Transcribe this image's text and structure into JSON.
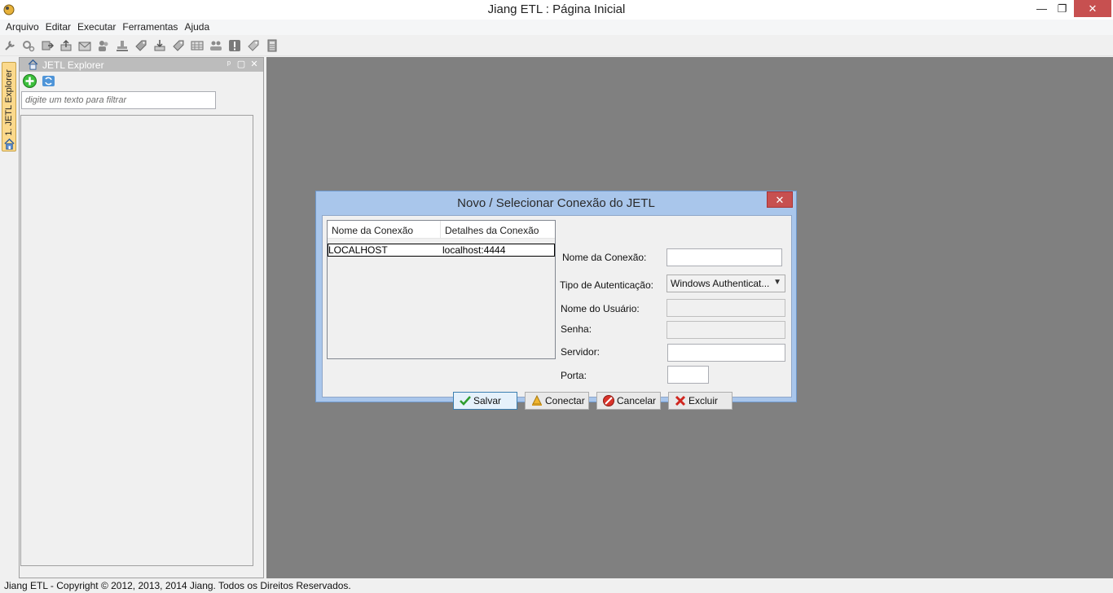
{
  "window": {
    "title": "Jiang ETL : Página Inicial",
    "minimize": "—",
    "maximize": "❐",
    "close": "✕"
  },
  "menu": [
    "Arquivo",
    "Editar",
    "Executar",
    "Ferramentas",
    "Ajuda"
  ],
  "toolbar": {
    "icons": [
      "wrench-icon",
      "gear-cluster-icon",
      "export-icon",
      "upload-icon",
      "mail-icon",
      "users-icon",
      "stamp-icon",
      "tag-icon",
      "download-icon",
      "tag-icon-2",
      "table-icon",
      "group-icon",
      "alert-icon",
      "tag-icon-3",
      "calculator-icon"
    ]
  },
  "left_strip": {
    "tab_label": "1. JETL Explorer"
  },
  "explorer": {
    "title": "JETL Explorer",
    "pin": "ᵖ",
    "float": "▢",
    "close": "✕",
    "filter_placeholder": "digite um texto para filtrar"
  },
  "dialog": {
    "title": "Novo / Selecionar Conexão do JETL",
    "close": "✕",
    "table": {
      "headers": [
        "Nome da Conexão",
        "Detalhes da Conexão"
      ],
      "rows": [
        [
          "LOCALHOST",
          "localhost:4444"
        ]
      ]
    },
    "form": {
      "connection_name_label": "Nome da Conexão:",
      "connection_name_value": "",
      "auth_type_label": "Tipo de Autenticação:",
      "auth_type_value": "Windows Authenticat...",
      "username_label": "Nome do Usuário:",
      "username_value": "",
      "password_label": "Senha:",
      "password_value": "",
      "server_label": "Servidor:",
      "server_value": "",
      "port_label": "Porta:",
      "port_value": ""
    },
    "buttons": {
      "save": "Salvar",
      "connect": "Conectar",
      "cancel": "Cancelar",
      "delete": "Excluir"
    }
  },
  "status": {
    "text": "Jiang ETL - Copyright © 2012, 2013, 2014 Jiang. Todos os Direitos Reservados."
  },
  "colors": {
    "workspace": "#808080",
    "dialog_frame": "#a9c6eb",
    "close_red": "#c75050",
    "vtab_orange": "#fbd98c"
  }
}
